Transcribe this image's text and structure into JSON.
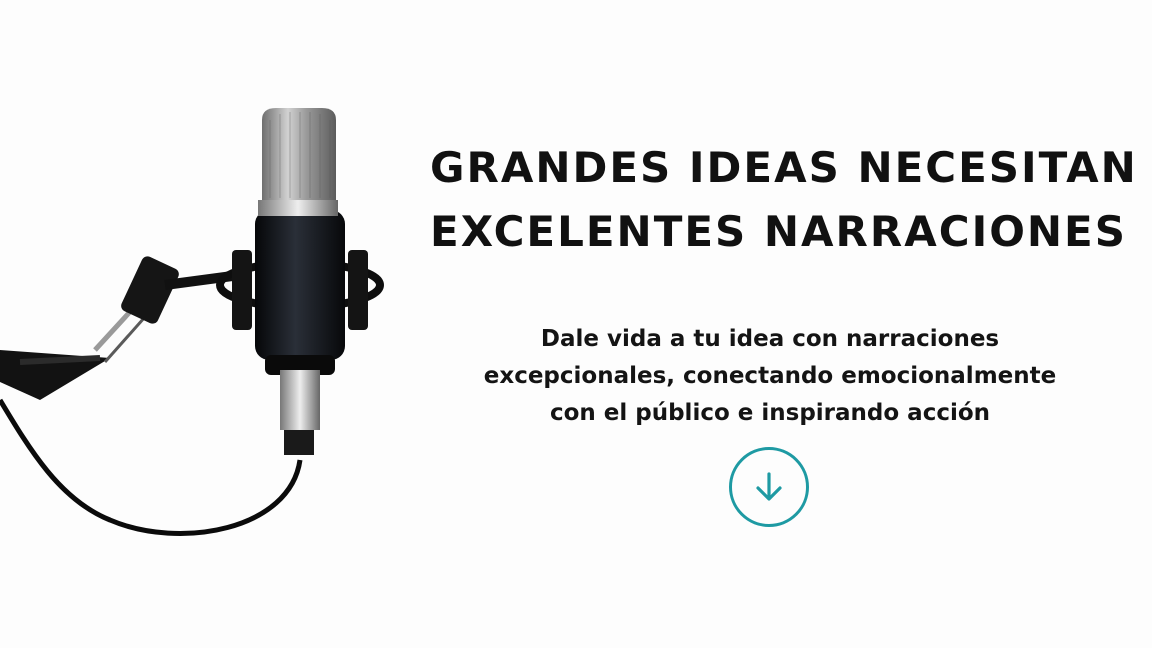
{
  "hero": {
    "title_lines": [
      "GRANDES IDEAS NECESITAN",
      "EXCELENTES NARRACIONES"
    ],
    "subtitle_lines": [
      "Dale vida a tu idea con narraciones",
      "excepcionales, conectando emocionalmente",
      "con el público e inspirando acción"
    ],
    "scroll_button": {
      "icon": "arrow-down-icon",
      "color": "#1e9aa3"
    },
    "image": {
      "icon": "microphone-image"
    }
  },
  "colors": {
    "background": "#fdfdfd",
    "text": "#111111",
    "accent": "#1e9aa3"
  }
}
